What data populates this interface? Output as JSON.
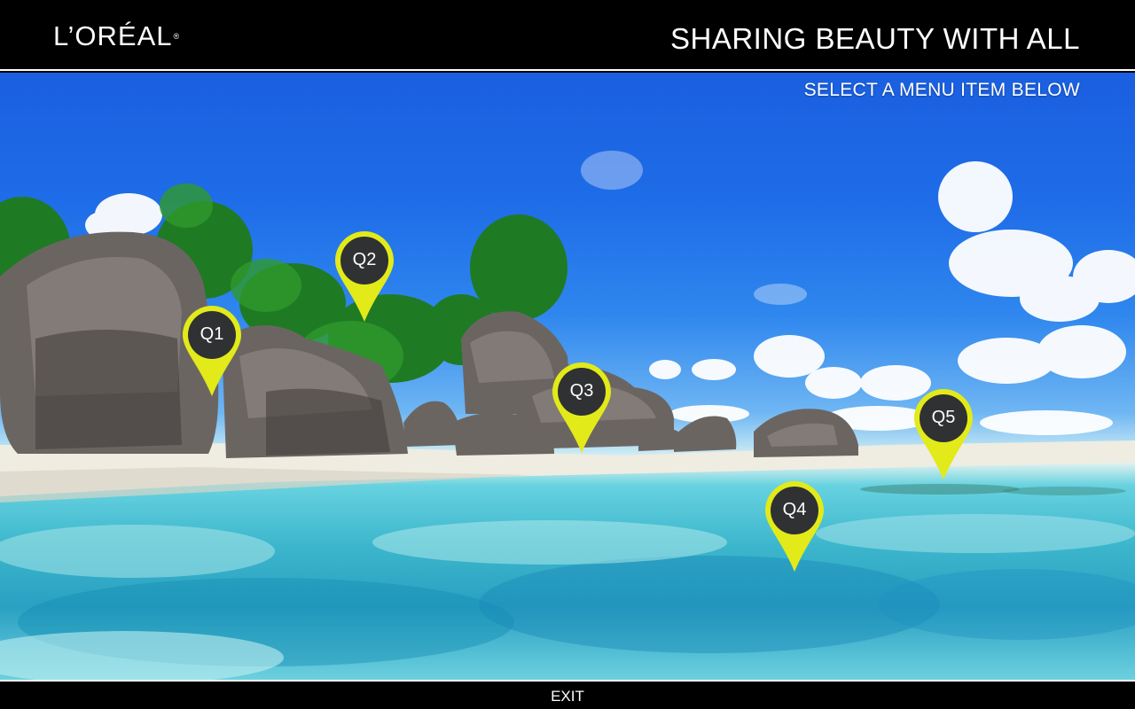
{
  "header": {
    "logo_text": "L’ORÉAL",
    "logo_mark": "®",
    "tagline": "SHARING BEAUTY WITH ALL"
  },
  "instruction": "SELECT A MENU ITEM BELOW",
  "pins": [
    {
      "label": "Q1"
    },
    {
      "label": "Q2"
    },
    {
      "label": "Q3"
    },
    {
      "label": "Q4"
    },
    {
      "label": "Q5"
    }
  ],
  "footer": {
    "exit_label": "EXIT"
  },
  "colors": {
    "pin_ring": "#e2ea19",
    "pin_center": "#2f3133",
    "bar": "#000000"
  }
}
